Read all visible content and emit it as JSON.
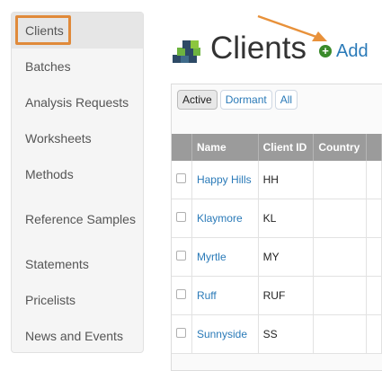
{
  "sidebar": {
    "items": [
      {
        "label": "Clients",
        "active": true
      },
      {
        "label": "Batches"
      },
      {
        "label": "Analysis Requests"
      },
      {
        "label": "Worksheets"
      },
      {
        "label": "Methods"
      },
      {
        "label": "Reference Samples"
      },
      {
        "label": "Statements"
      },
      {
        "label": "Pricelists"
      },
      {
        "label": "News and Events"
      }
    ]
  },
  "header": {
    "title": "Clients",
    "icon": "clients-blocks-icon",
    "add_label": "Add",
    "add_icon": "plus-circle-icon"
  },
  "filters": [
    {
      "label": "Active",
      "selected": true
    },
    {
      "label": "Dormant"
    },
    {
      "label": "All"
    }
  ],
  "table": {
    "columns": [
      "",
      "Name",
      "Client ID",
      "Country",
      ""
    ],
    "rows": [
      {
        "name": "Happy Hills",
        "client_id": "HH",
        "country": ""
      },
      {
        "name": "Klaymore",
        "client_id": "KL",
        "country": ""
      },
      {
        "name": "Myrtle",
        "client_id": "MY",
        "country": ""
      },
      {
        "name": "Ruff",
        "client_id": "RUF",
        "country": ""
      },
      {
        "name": "Sunnyside",
        "client_id": "SS",
        "country": ""
      }
    ]
  },
  "colors": {
    "highlight": "#e08a3a",
    "link": "#2a7ab8",
    "header_bg": "#9b9b9b",
    "arrow": "#e8913a"
  }
}
